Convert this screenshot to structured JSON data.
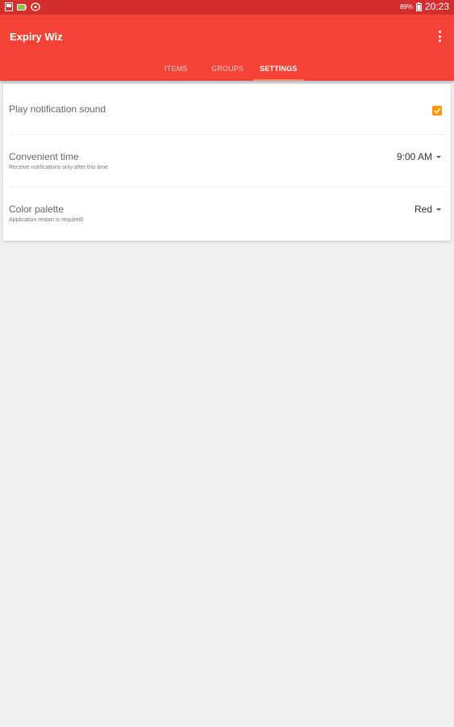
{
  "status_bar": {
    "battery_percent": "89%",
    "time": "20:23"
  },
  "app": {
    "title": "Expiry Wiz",
    "brand_color": "#f44336",
    "statusbar_color": "#d32f2f",
    "accent_color": "#ff9800"
  },
  "tabs": [
    {
      "label": "ITEMS",
      "active": false
    },
    {
      "label": "GROUPS",
      "active": false
    },
    {
      "label": "SETTINGS",
      "active": true
    }
  ],
  "settings": {
    "notification_sound": {
      "title": "Play notification sound",
      "checked": true
    },
    "convenient_time": {
      "title": "Convenient time",
      "subtitle": "Receive notifications only after this time",
      "value": "9:00 AM"
    },
    "color_palette": {
      "title": "Color palette",
      "subtitle": "Application restart is required!",
      "value": "Red"
    }
  }
}
